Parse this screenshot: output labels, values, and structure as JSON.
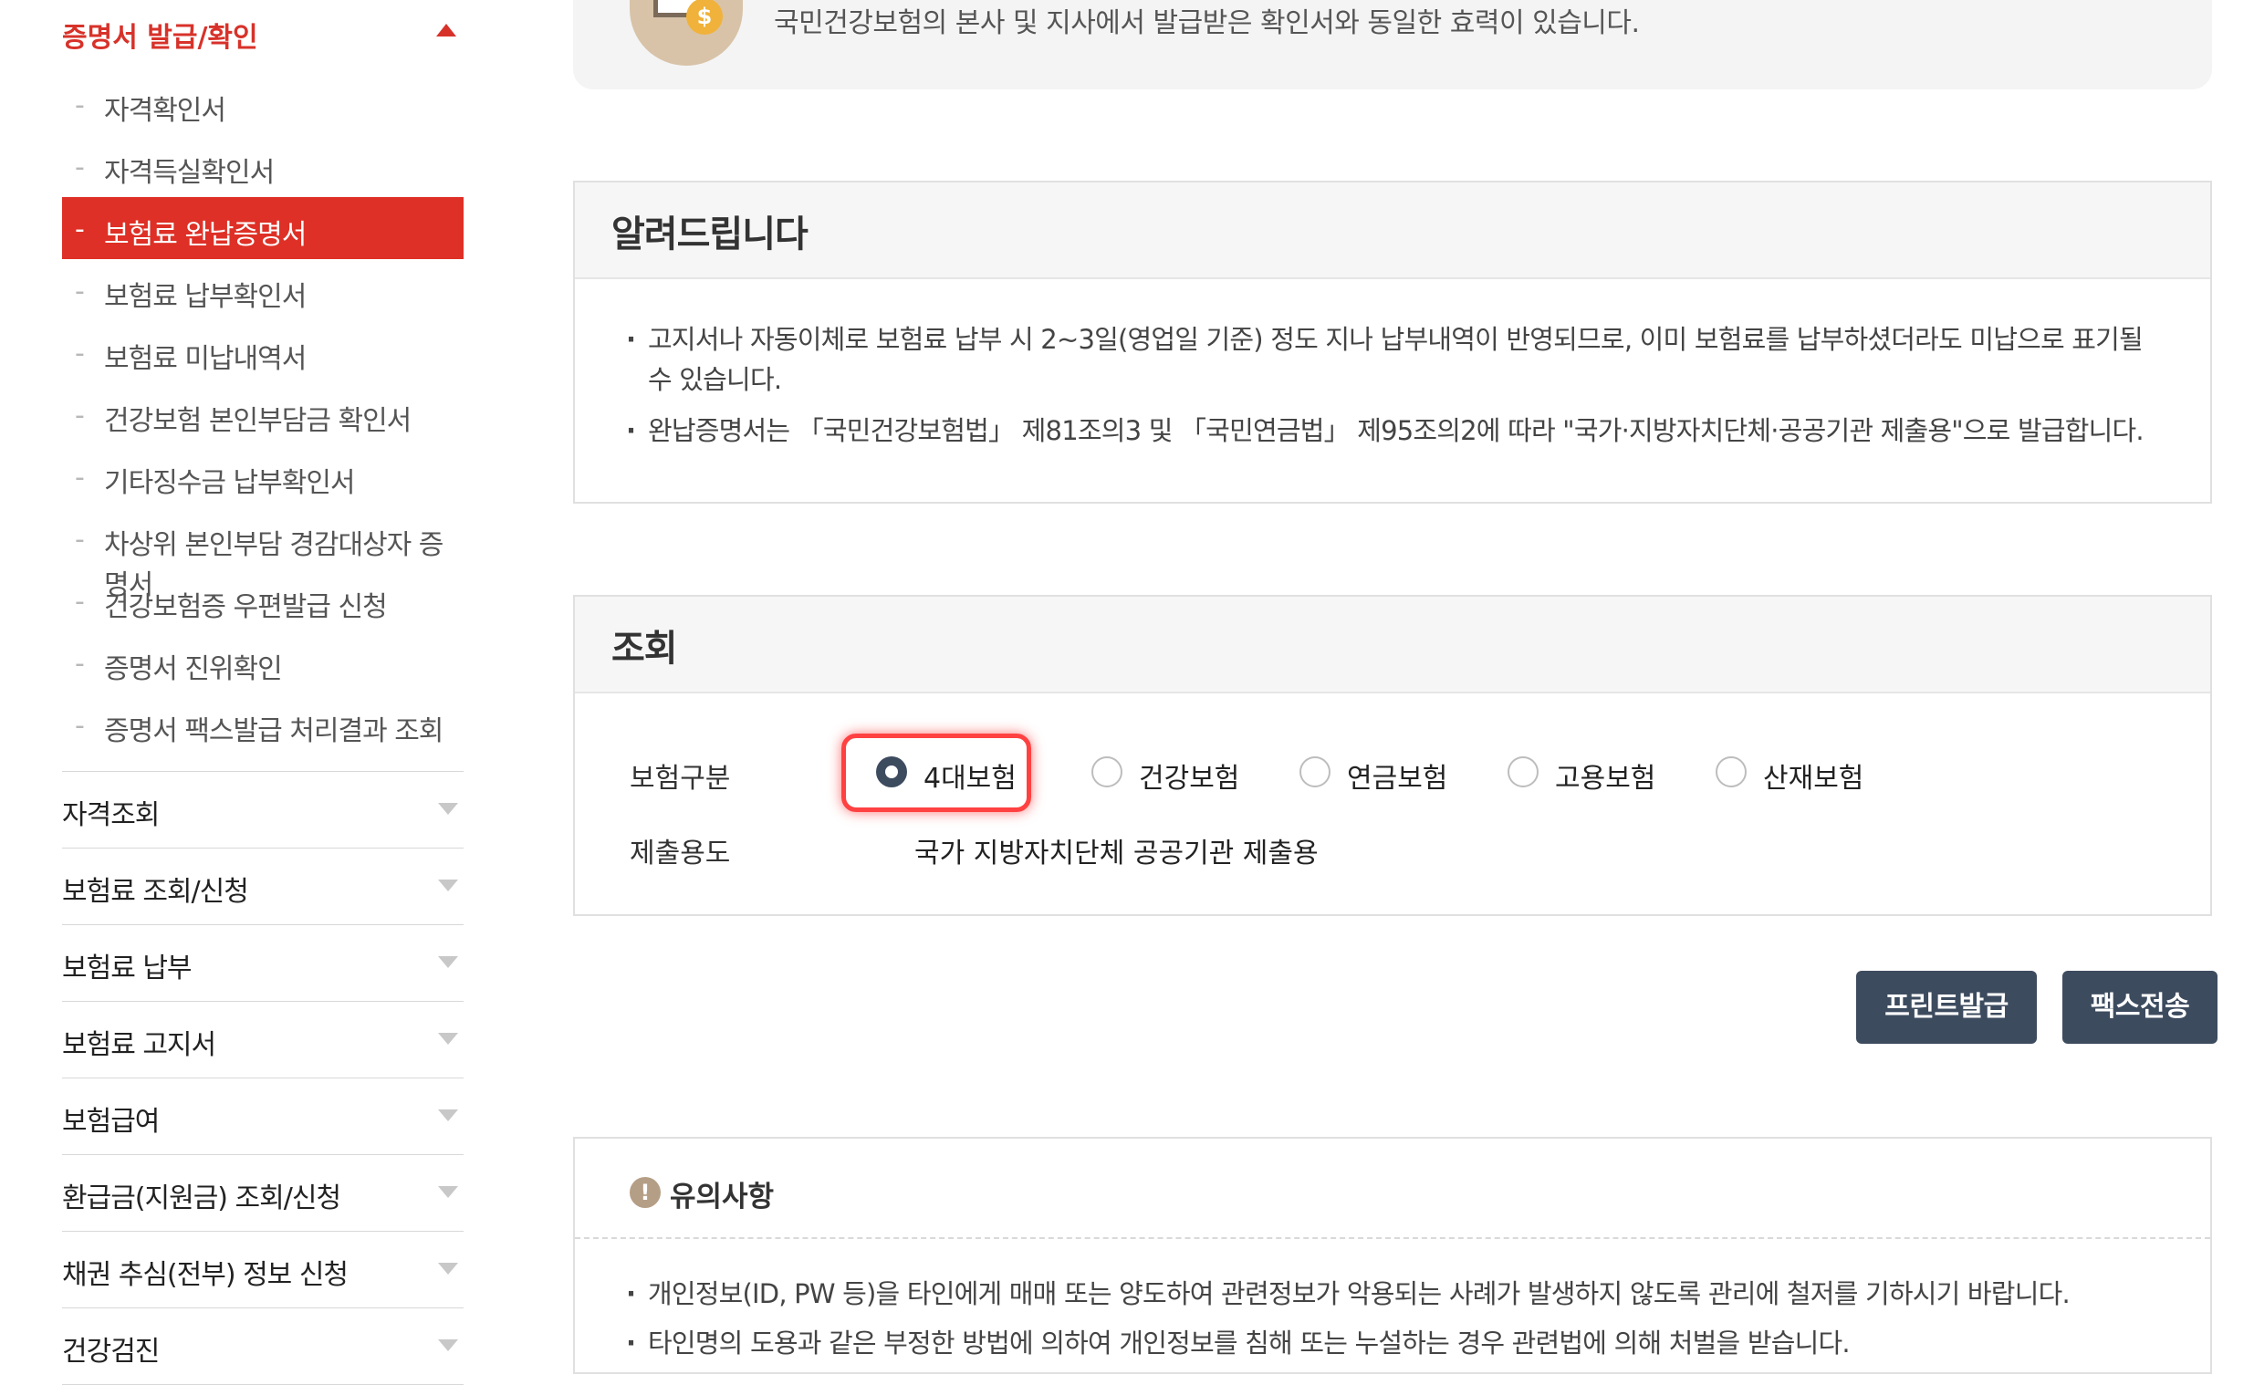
{
  "sidebar": {
    "section_title": "증명서 발급/확인",
    "sub_items": [
      {
        "label": "자격확인서",
        "active": false
      },
      {
        "label": "자격득실확인서",
        "active": false
      },
      {
        "label": "보험료 완납증명서",
        "active": true
      },
      {
        "label": "보험료 납부확인서",
        "active": false
      },
      {
        "label": "보험료 미납내역서",
        "active": false
      },
      {
        "label": "건강보험 본인부담금 확인서",
        "active": false
      },
      {
        "label": "기타징수금 납부확인서",
        "active": false
      },
      {
        "label": "차상위 본인부담 경감대상자 증명서",
        "active": false
      },
      {
        "label": "건강보험증 우편발급 신청",
        "active": false
      },
      {
        "label": "증명서 진위확인",
        "active": false
      },
      {
        "label": "증명서 팩스발급 처리결과 조회",
        "active": false
      }
    ],
    "menu_items": [
      "자격조회",
      "보험료 조회/신청",
      "보험료 납부",
      "보험료 고지서",
      "보험급여",
      "환급금(지원금) 조회/신청",
      "채권 추심(전부) 정보 신청",
      "건강검진"
    ]
  },
  "top_box": {
    "text": "국민건강보험의 본사 및 지사에서 발급받은 확인서와 동일한 효력이 있습니다.",
    "icon": "computer-coin-icon"
  },
  "notice": {
    "title": "알려드립니다",
    "bullets": [
      "고지서나 자동이체로 보험료 납부 시 2~3일(영업일 기준) 정도 지나 납부내역이 반영되므로, 이미 보험료를 납부하셨더라도 미납으로 표기될 수 있습니다.",
      "완납증명서는 「국민건강보험법」 제81조의3 및 「국민연금법」 제95조의2에 따라 \"국가·지방자치단체·공공기관 제출용\"으로 발급합니다."
    ]
  },
  "lookup": {
    "title": "조회",
    "insurance_label": "보험구분",
    "options": [
      "4대보험",
      "건강보험",
      "연금보험",
      "고용보험",
      "산재보험"
    ],
    "selected": "4대보험",
    "purpose_label": "제출용도",
    "purpose_value": "국가 지방자치단체 공공기관 제출용"
  },
  "buttons": {
    "print": "프린트발급",
    "fax": "팩스전송"
  },
  "caution": {
    "title": "유의사항",
    "icon": "exclamation-icon",
    "bullets": [
      "개인정보(ID, PW 등)을 타인에게 매매 또는 양도하여 관련정보가 악용되는 사례가 발생하지 않도록 관리에 철저를 기하시기 바랍니다.",
      "타인명의 도용과 같은 부정한 방법에 의하여 개인정보를 침해 또는 누설하는 경우 관련법에 의해 처벌을 받습니다."
    ]
  },
  "colors": {
    "accent_red": "#de3026",
    "button_navy": "#3d4b5f",
    "highlight_ring": "#ff4141"
  }
}
